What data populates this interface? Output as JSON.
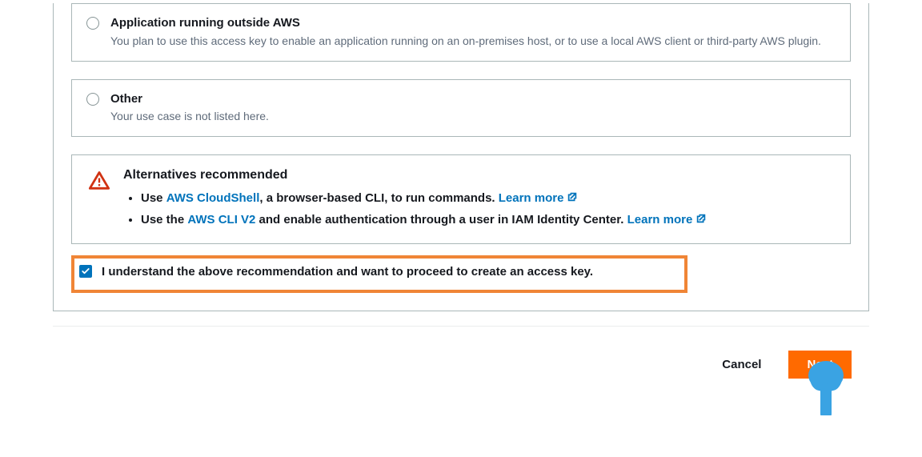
{
  "options": [
    {
      "title": "Application running outside AWS",
      "desc": "You plan to use this access key to enable an application running on an on-premises host, or to use a local AWS client or third-party AWS plugin."
    },
    {
      "title": "Other",
      "desc": "Your use case is not listed here."
    }
  ],
  "alert": {
    "title": "Alternatives recommended",
    "bullet1_pre": "Use ",
    "bullet1_link": "AWS CloudShell",
    "bullet1_post": ", a browser-based CLI, to run commands. ",
    "bullet1_learn": "Learn more",
    "bullet2_pre": "Use the ",
    "bullet2_link": "AWS CLI V2",
    "bullet2_post": " and enable authentication through a user in IAM Identity Center. ",
    "bullet2_learn": "Learn more"
  },
  "consent_label": "I understand the above recommendation and want to proceed to create an access key.",
  "footer": {
    "cancel": "Cancel",
    "next": "Next"
  }
}
